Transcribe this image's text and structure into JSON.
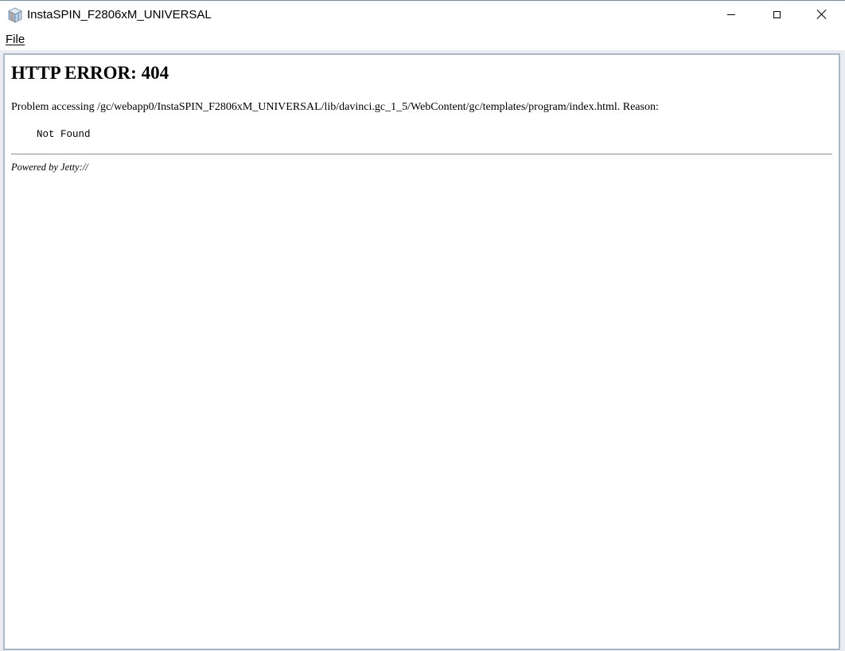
{
  "window": {
    "title": "InstaSPIN_F2806xM_UNIVERSAL",
    "icon": "java-cube-icon",
    "controls": {
      "minimize": "minimize-icon",
      "maximize": "maximize-icon",
      "close": "close-icon"
    }
  },
  "menubar": {
    "items": [
      {
        "label": "File",
        "mnemonic": "F",
        "rest": "ile"
      }
    ]
  },
  "page": {
    "heading": "HTTP ERROR: 404",
    "message": "Problem accessing /gc/webapp0/InstaSPIN_F2806xM_UNIVERSAL/lib/davinci.gc_1_5/WebContent/gc/templates/program/index.html. Reason:",
    "reason": "Not Found",
    "footer": "Powered by Jetty://"
  },
  "colors": {
    "frame_border": "#a9b8c8",
    "window_accent": "#6d8cb1"
  }
}
